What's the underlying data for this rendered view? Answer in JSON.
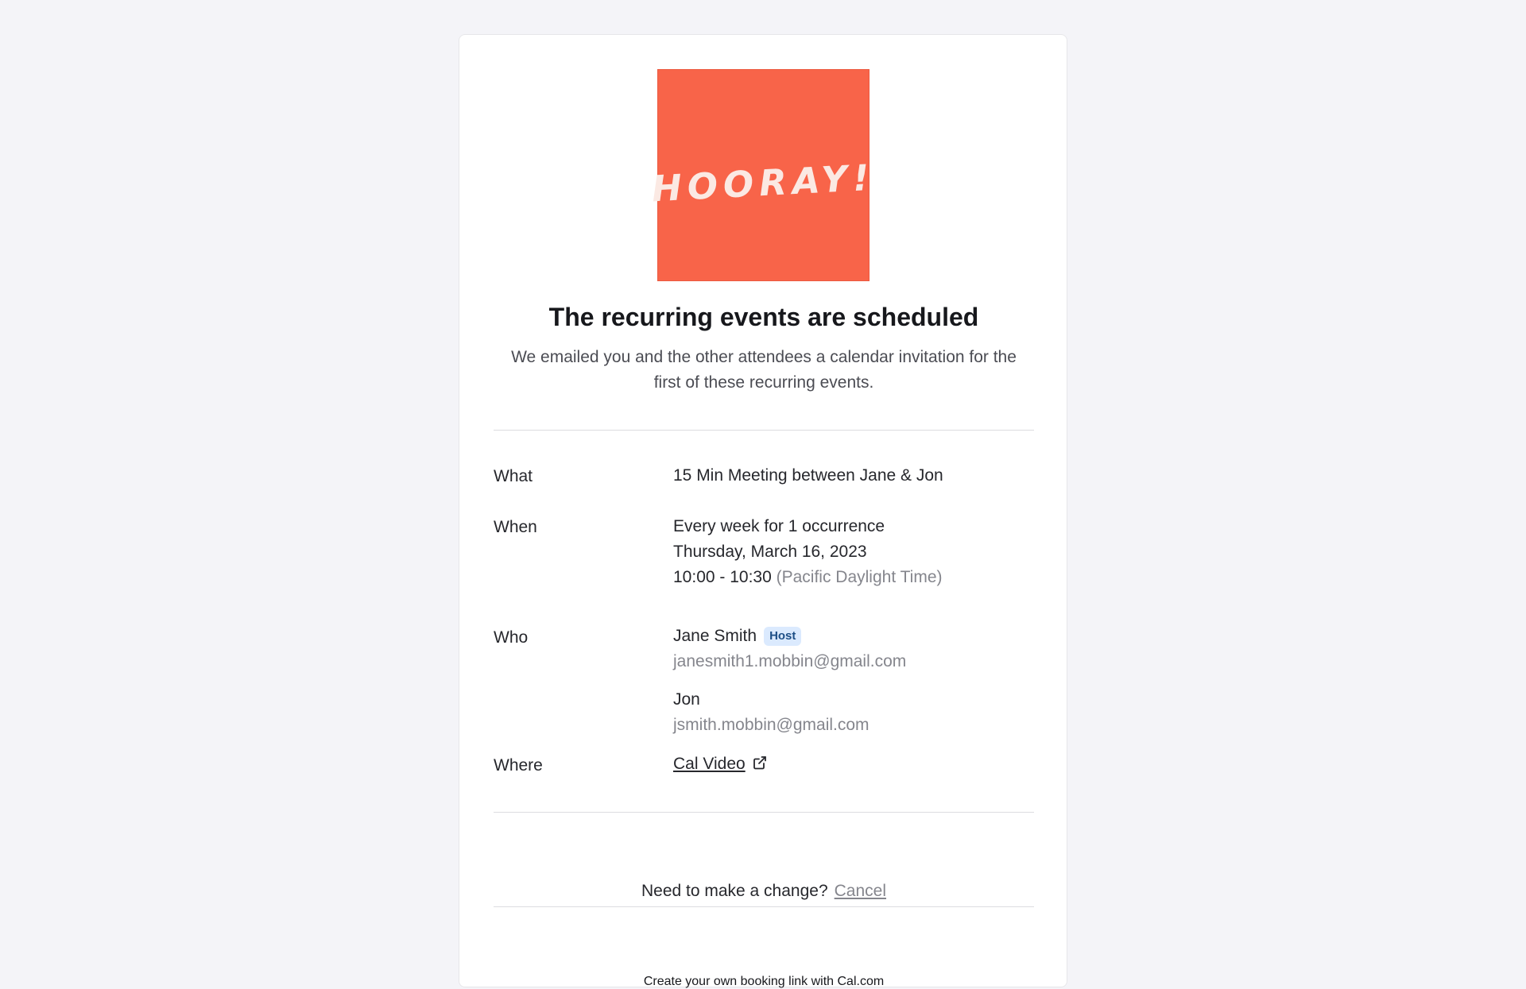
{
  "hero": {
    "image_text": "HOORAY!",
    "image_color": "#f86449"
  },
  "heading": {
    "title": "The recurring events are scheduled",
    "subtitle": "We emailed you and the other attendees a calendar invitation for the first of these recurring events."
  },
  "details": {
    "what": {
      "label": "What",
      "value": "15 Min Meeting between Jane & Jon"
    },
    "when": {
      "label": "When",
      "recurrence": "Every week for 1 occurrence",
      "date": "Thursday, March 16, 2023",
      "time": "10:00 - 10:30",
      "timezone": "(Pacific Daylight Time)"
    },
    "who": {
      "label": "Who",
      "attendees": [
        {
          "name": "Jane Smith",
          "badge": "Host",
          "email": "janesmith1.mobbin@gmail.com"
        },
        {
          "name": "Jon",
          "email": "jsmith.mobbin@gmail.com"
        }
      ]
    },
    "where": {
      "label": "Where",
      "link_text": "Cal Video",
      "icon": "external-link-icon"
    }
  },
  "change": {
    "prompt": "Need to make a change?",
    "cancel_label": "Cancel"
  },
  "footer": {
    "text": "Create your own booking link with Cal.com"
  }
}
